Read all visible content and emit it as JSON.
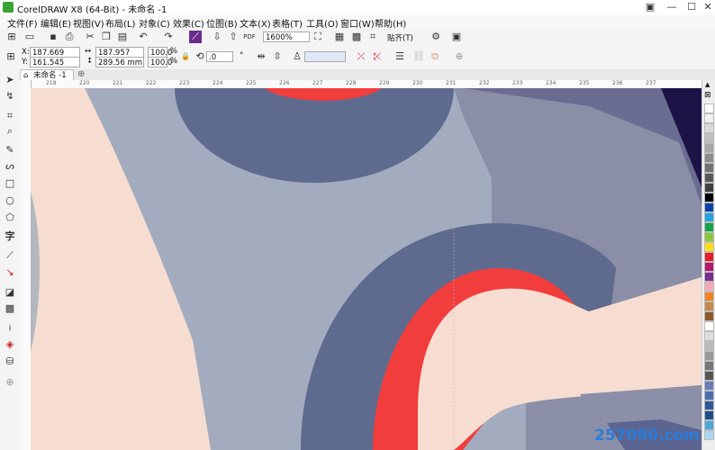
{
  "window": {
    "title": "CorelDRAW X8 (64-Bit) - 未命名 -1"
  },
  "menu": [
    "文件(F)",
    "编辑(E)",
    "视图(V)",
    "布局(L)",
    "对象(C)",
    "效果(C)",
    "位图(B)",
    "文本(X)",
    "表格(T)",
    "工具(O)",
    "窗口(W)",
    "帮助(H)"
  ],
  "toolbar": {
    "zoom": "1600%",
    "snap_label": "贴齐(T)"
  },
  "props": {
    "x_label": "X:",
    "x_value": "187.669 mm",
    "y_label": "Y:",
    "y_value": "161.545 mm",
    "w_value": "187.957 mm",
    "h_value": "289.56 mm",
    "scale_x": "100.0",
    "scale_y": "100.0",
    "percent": "%",
    "angle": ".0"
  },
  "document": {
    "tab": "未命名 -1"
  },
  "ruler": {
    "marks": [
      "219",
      "220",
      "221",
      "222",
      "223",
      "224",
      "225",
      "226",
      "227",
      "228",
      "229",
      "230",
      "231",
      "232",
      "233",
      "234",
      "235",
      "236",
      "237"
    ]
  },
  "palette_colors": [
    "#ffffff",
    "#f2f2f2",
    "#d9d9d9",
    "#bfbfbf",
    "#a6a6a6",
    "#8c8c8c",
    "#737373",
    "#595959",
    "#404040",
    "#000000",
    "#0d3fa6",
    "#22a3e0",
    "#14a44d",
    "#8cc63f",
    "#ffde17",
    "#e31e24",
    "#b5176b",
    "#7b2e8e",
    "#f7a8b8",
    "#f58220",
    "#c48a4a",
    "#8e5a2b",
    "#ffffff",
    "#dddddd",
    "#bbbbbb",
    "#999999",
    "#777777",
    "#555555",
    "#6a7bb8",
    "#4c6fb1",
    "#2e5a9a",
    "#1d4e89",
    "#4aa8d8",
    "#aad7f0"
  ],
  "watermark": "257090.com",
  "colors": {
    "accent": "#3aa335",
    "canvas_red": "#f23d3d",
    "canvas_navy": "#5f6a92",
    "canvas_skin": "#f7ddd1"
  }
}
